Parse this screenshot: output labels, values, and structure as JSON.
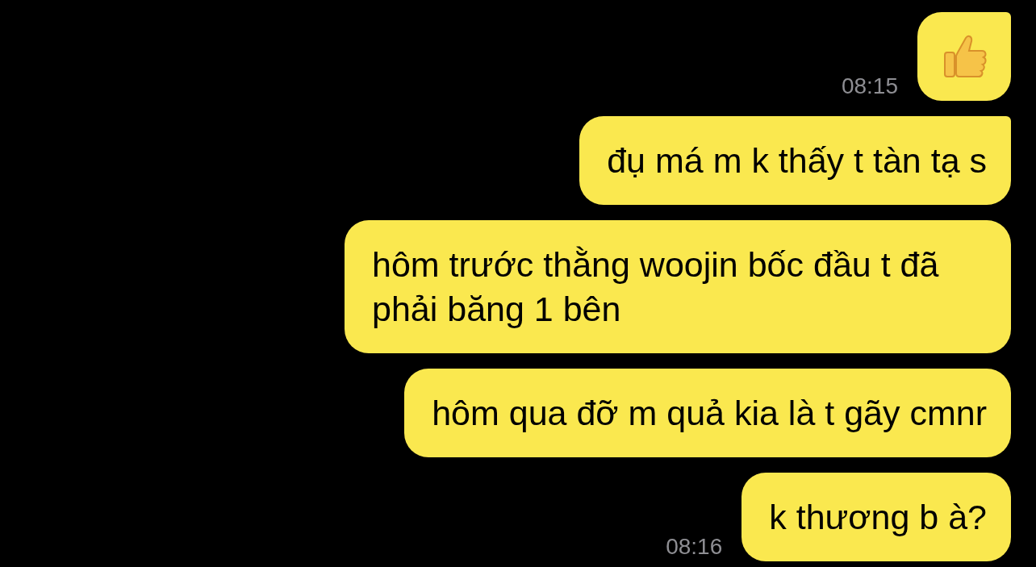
{
  "messages": [
    {
      "kind": "thumbs_up",
      "tail": true,
      "time": "08:15"
    },
    {
      "kind": "text",
      "tail": true,
      "text": "đụ má m k thấy t tàn tạ s"
    },
    {
      "kind": "text",
      "tail": false,
      "text": "hôm trước thằng woojin bốc đầu t đã phải băng 1 bên"
    },
    {
      "kind": "text",
      "tail": false,
      "text": "hôm qua đỡ m quả kia là t gãy cmnr"
    },
    {
      "kind": "text",
      "tail": false,
      "text": "k thương b à?",
      "time": "08:16"
    }
  ]
}
